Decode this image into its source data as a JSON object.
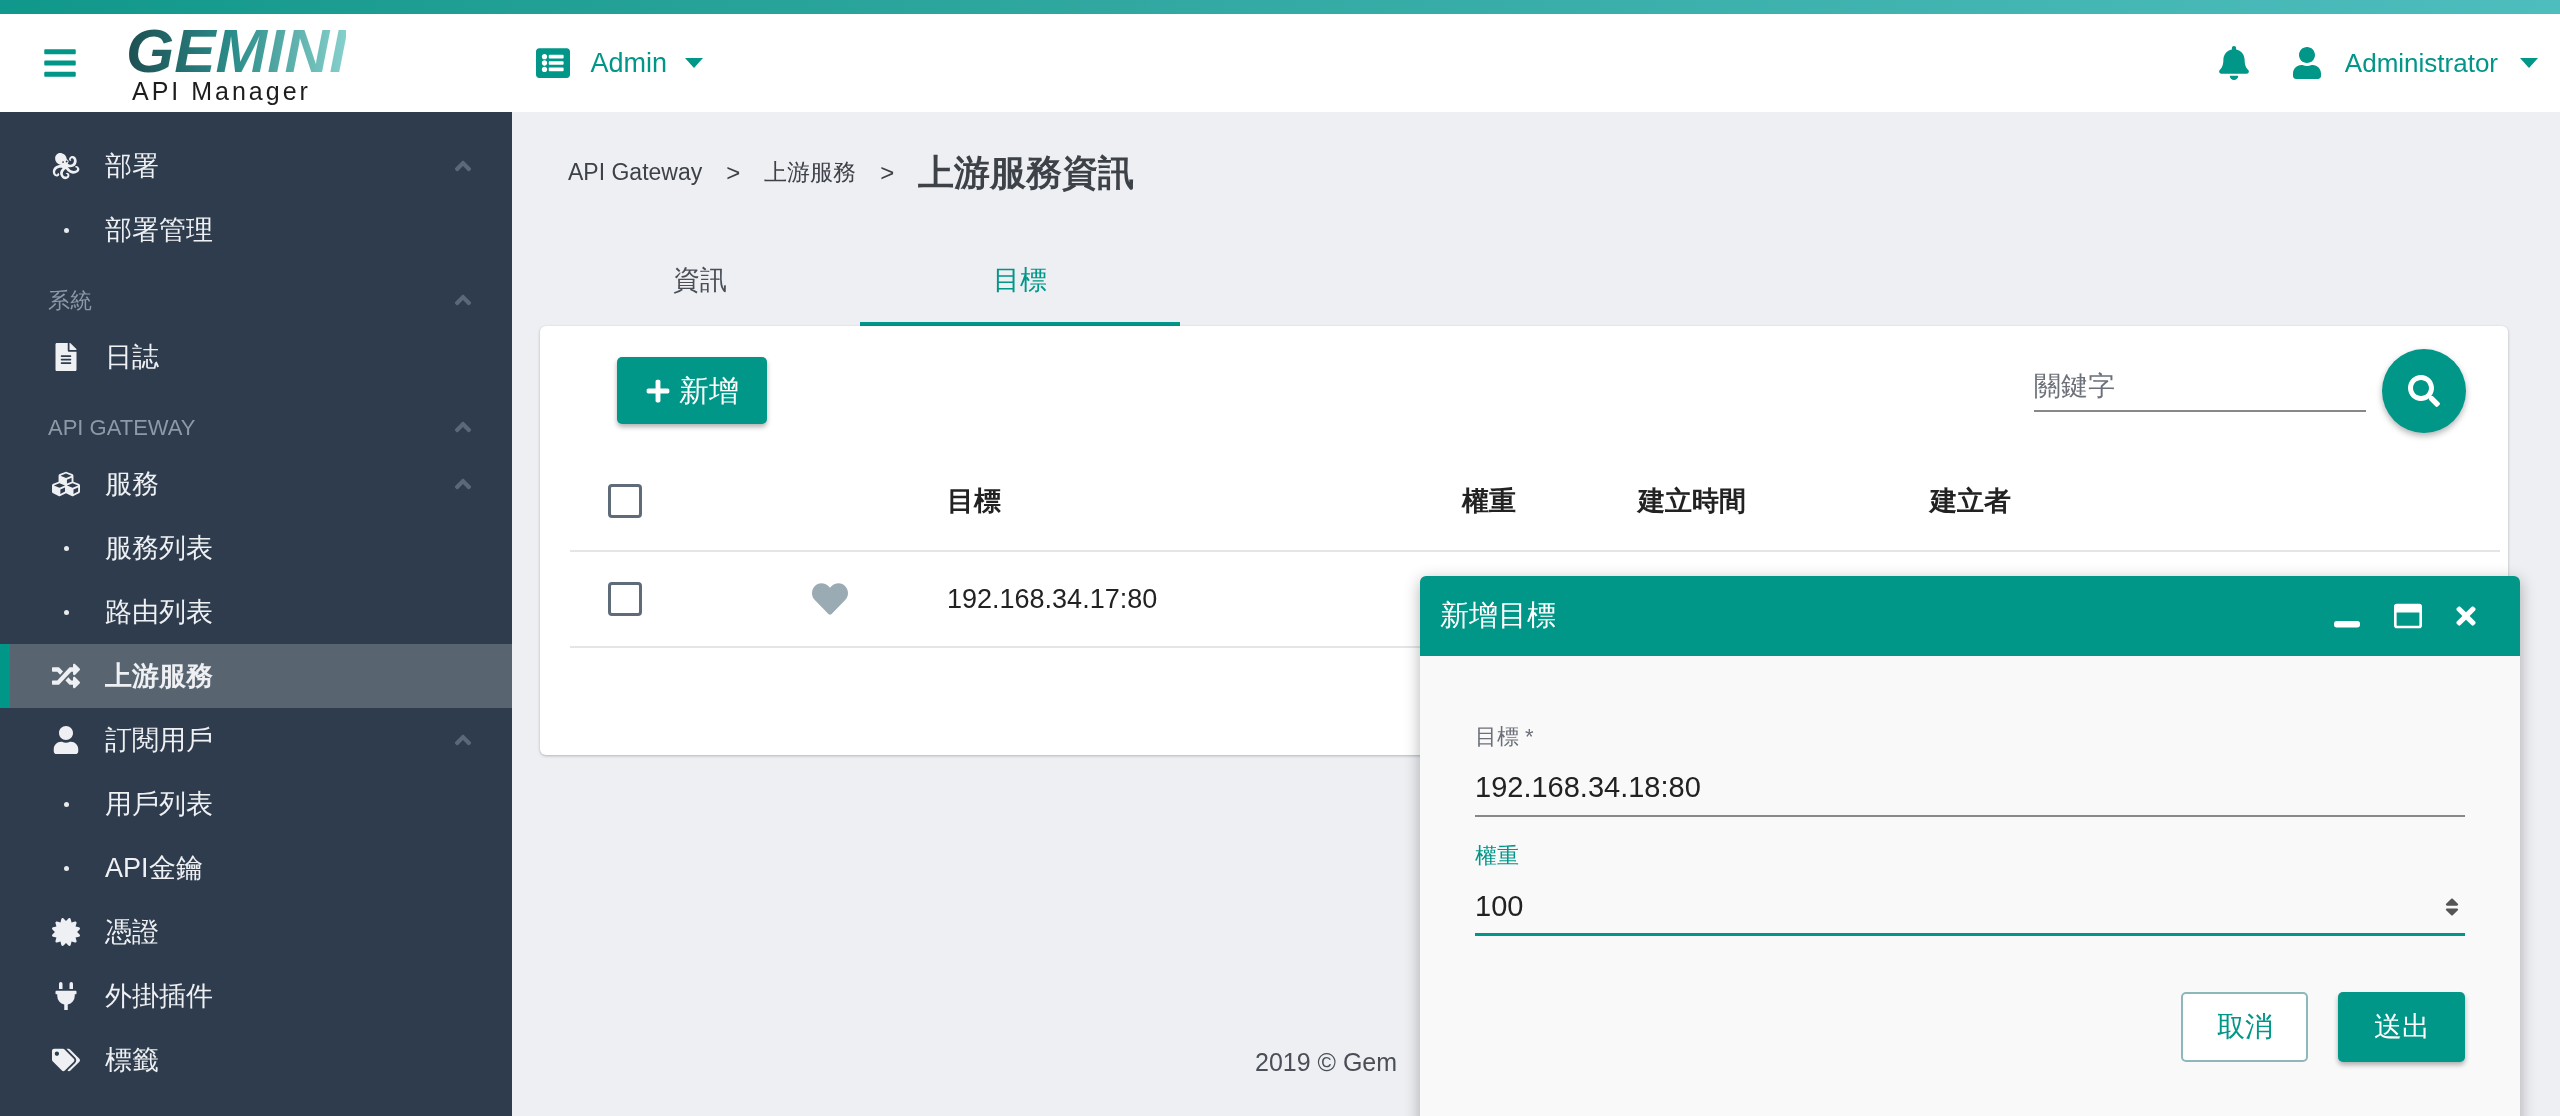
{
  "header": {
    "logo_title": "GEMINI",
    "logo_subtitle": "API Manager",
    "workspace_menu": "Admin",
    "user_menu": "Administrator"
  },
  "sidebar": {
    "items": [
      {
        "kind": "item",
        "label": "部署",
        "expanded": true,
        "selected": false
      },
      {
        "kind": "subitem",
        "label": "部署管理",
        "selected": false
      },
      {
        "kind": "section",
        "label": "系統",
        "expanded": true
      },
      {
        "kind": "item",
        "label": "日誌",
        "selected": false
      },
      {
        "kind": "section",
        "label": "API GATEWAY",
        "expanded": true
      },
      {
        "kind": "item",
        "label": "服務",
        "expanded": true,
        "selected": false
      },
      {
        "kind": "subitem",
        "label": "服務列表",
        "selected": false
      },
      {
        "kind": "subitem",
        "label": "路由列表",
        "selected": false
      },
      {
        "kind": "item",
        "label": "上游服務",
        "selected": true
      },
      {
        "kind": "item",
        "label": "訂閱用戶",
        "expanded": true,
        "selected": false
      },
      {
        "kind": "subitem",
        "label": "用戶列表",
        "selected": false
      },
      {
        "kind": "subitem",
        "label": "API金鑰",
        "selected": false
      },
      {
        "kind": "item",
        "label": "憑證",
        "selected": false
      },
      {
        "kind": "item",
        "label": "外掛插件",
        "selected": false
      },
      {
        "kind": "item",
        "label": "標籤",
        "selected": false
      }
    ]
  },
  "breadcrumb": [
    {
      "kind": "link",
      "label": "API Gateway"
    },
    {
      "kind": "separator",
      "label": ">"
    },
    {
      "kind": "link",
      "label": "上游服務"
    },
    {
      "kind": "separator",
      "label": ">"
    },
    {
      "kind": "current",
      "label": "上游服務資訊"
    }
  ],
  "tabs": [
    {
      "label": "資訊",
      "selected": false
    },
    {
      "label": "目標",
      "selected": true
    }
  ],
  "toolbar": {
    "add_button": "新增",
    "search": {
      "placeholder": "關鍵字"
    }
  },
  "table": {
    "select_all_checked": false,
    "columns": [
      "目標",
      "權重",
      "建立時間",
      "建立者"
    ],
    "rows": [
      {
        "checked": false,
        "target": "192.168.34.17:80"
      }
    ]
  },
  "footer": "2019 © Gem",
  "dialog": {
    "title": "新增目標",
    "fields": [
      {
        "kind": "text",
        "label": "目標 *",
        "value": "192.168.34.18:80",
        "focused": false
      },
      {
        "kind": "number",
        "label": "權重",
        "value": "100",
        "focused": true
      }
    ],
    "buttons": [
      {
        "kind": "outline",
        "label": "取消"
      },
      {
        "kind": "primary",
        "label": "送出"
      }
    ]
  }
}
